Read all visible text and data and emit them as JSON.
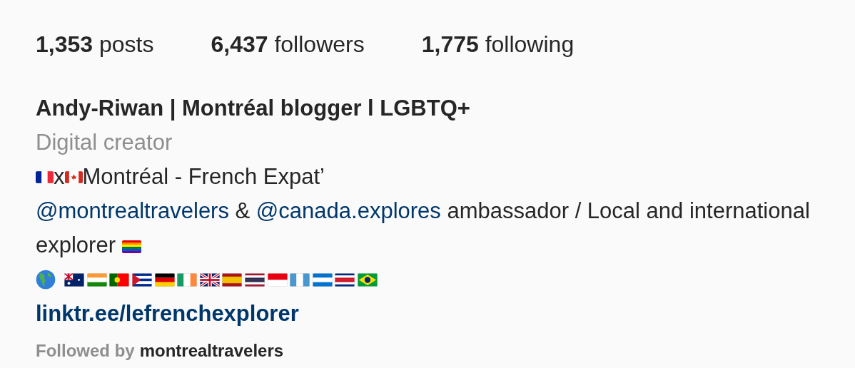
{
  "stats": [
    {
      "count": "1,353",
      "label": "posts"
    },
    {
      "count": "6,437",
      "label": "followers"
    },
    {
      "count": "1,775",
      "label": "following"
    }
  ],
  "profile": {
    "name": "Andy-Riwan | Montréal blogger l LGBTQ+",
    "category": "Digital creator",
    "origin_line": {
      "joiner": "x",
      "text": "Montréal - French Expat’"
    },
    "bio": [
      {
        "kind": "mention",
        "text": "@montrealtravelers"
      },
      {
        "kind": "text",
        "text": " & "
      },
      {
        "kind": "mention",
        "text": "@canada.explores"
      },
      {
        "kind": "text",
        "text": " ambassador / Local and international explorer"
      }
    ],
    "link": "linktr.ee/lefrenchexplorer"
  },
  "followed_by": {
    "prefix": "Followed by",
    "user": "montrealtravelers"
  }
}
